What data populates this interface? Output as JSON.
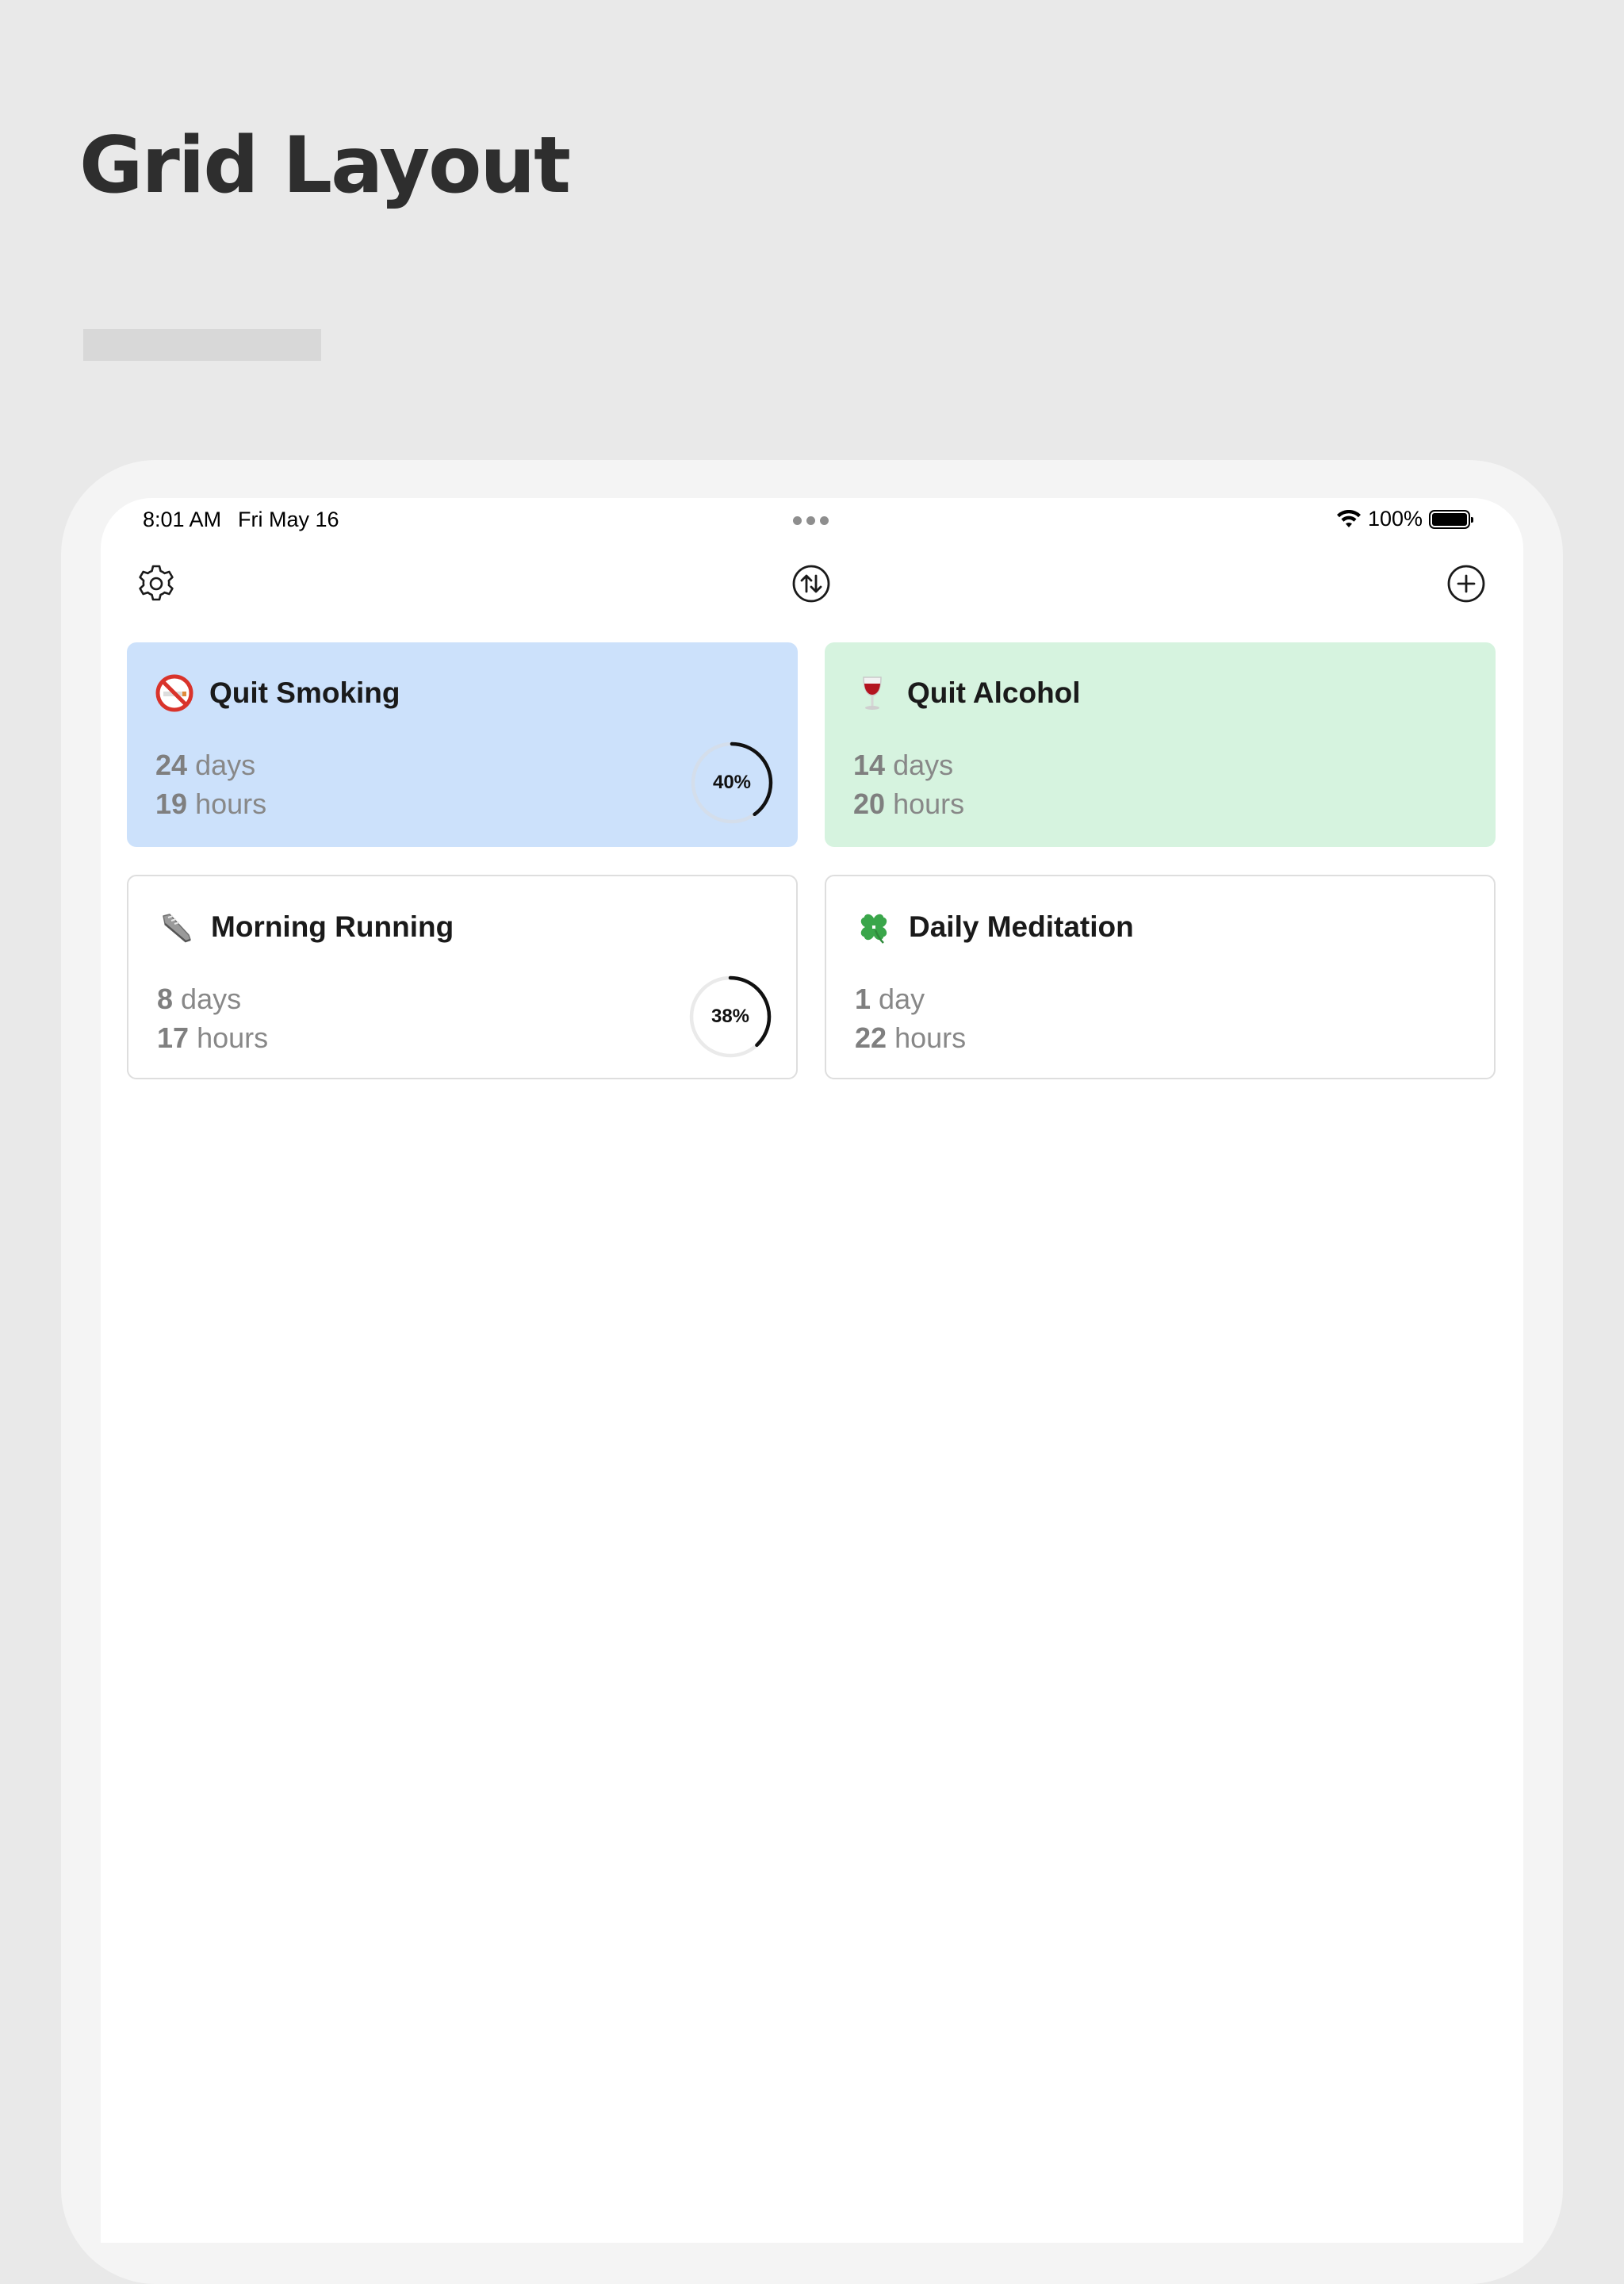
{
  "page": {
    "heading": "Grid Layout"
  },
  "status_bar": {
    "time": "8:01 AM",
    "date": "Fri May 16",
    "battery": "100%"
  },
  "toolbar": {
    "settings_icon": "gear-icon",
    "sort_icon": "sort-arrows-icon",
    "add_icon": "plus-circle-icon"
  },
  "cards": [
    {
      "title": "Quit Smoking",
      "icon": "no-smoking-icon",
      "days": "24",
      "days_unit": "days",
      "hours": "19",
      "hours_unit": "hours",
      "progress": 0.4,
      "progress_label": "40%",
      "color": "#cce1fb",
      "border": "none"
    },
    {
      "title": "Quit Alcohol",
      "icon": "wine-glass-icon",
      "days": "14",
      "days_unit": "days",
      "hours": "20",
      "hours_unit": "hours",
      "color": "#d6f3df",
      "border": "none"
    },
    {
      "title": "Morning Running",
      "icon": "running-shoe-icon",
      "days": "8",
      "days_unit": "days",
      "hours": "17",
      "hours_unit": "hours",
      "progress": 0.38,
      "progress_label": "38%",
      "color": "#ffffff",
      "border": "#dedede"
    },
    {
      "title": "Daily Meditation",
      "icon": "four-leaf-clover-icon",
      "days": "1",
      "days_unit": "day",
      "hours": "22",
      "hours_unit": "hours",
      "color": "#ffffff",
      "border": "#dedede"
    }
  ]
}
